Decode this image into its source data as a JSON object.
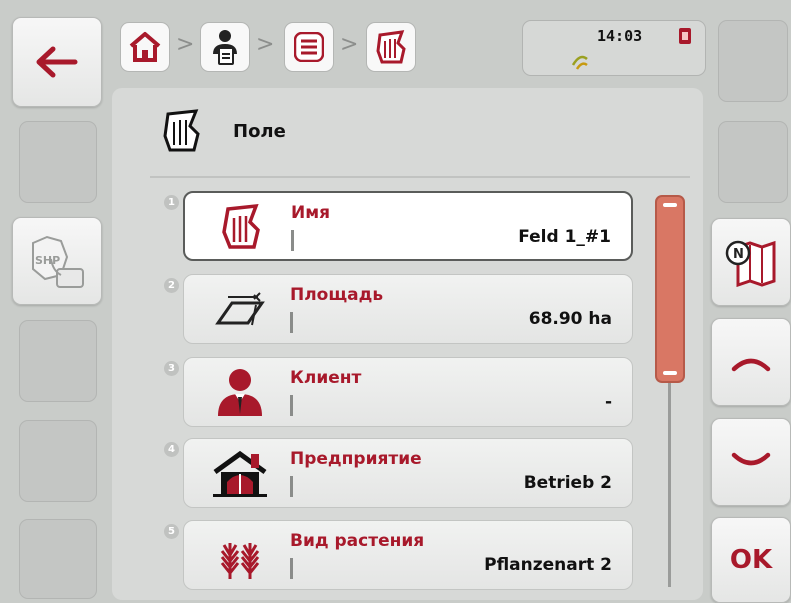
{
  "header": {
    "breadcrumb_icons": [
      "home-icon",
      "operator-icon",
      "menu-icon",
      "field-icon"
    ],
    "separator": ">",
    "time": "14:03"
  },
  "page": {
    "title": "Поле",
    "icon": "field-icon"
  },
  "items": [
    {
      "index": "1",
      "label": "Имя",
      "value": "Feld 1_#1",
      "icon": "field-icon"
    },
    {
      "index": "2",
      "label": "Площадь",
      "value": "68.90 ha",
      "icon": "area-icon"
    },
    {
      "index": "3",
      "label": "Клиент",
      "value": "-",
      "icon": "customer-icon"
    },
    {
      "index": "4",
      "label": "Предприятие",
      "value": "Betrieb 2",
      "icon": "farm-icon"
    },
    {
      "index": "5",
      "label": "Вид растения",
      "value": "Pflanzenart 2",
      "icon": "crop-icon"
    }
  ],
  "left_buttons": {
    "shp_label": "SHP"
  },
  "right_buttons": {
    "ok_label": "OK",
    "map_label": "N"
  },
  "colors": {
    "accent": "#a8192b",
    "scrollbar": "#d97764",
    "background": "#c9ccc9"
  },
  "scroll": {
    "visible_fraction": 0.44,
    "position": 0
  }
}
